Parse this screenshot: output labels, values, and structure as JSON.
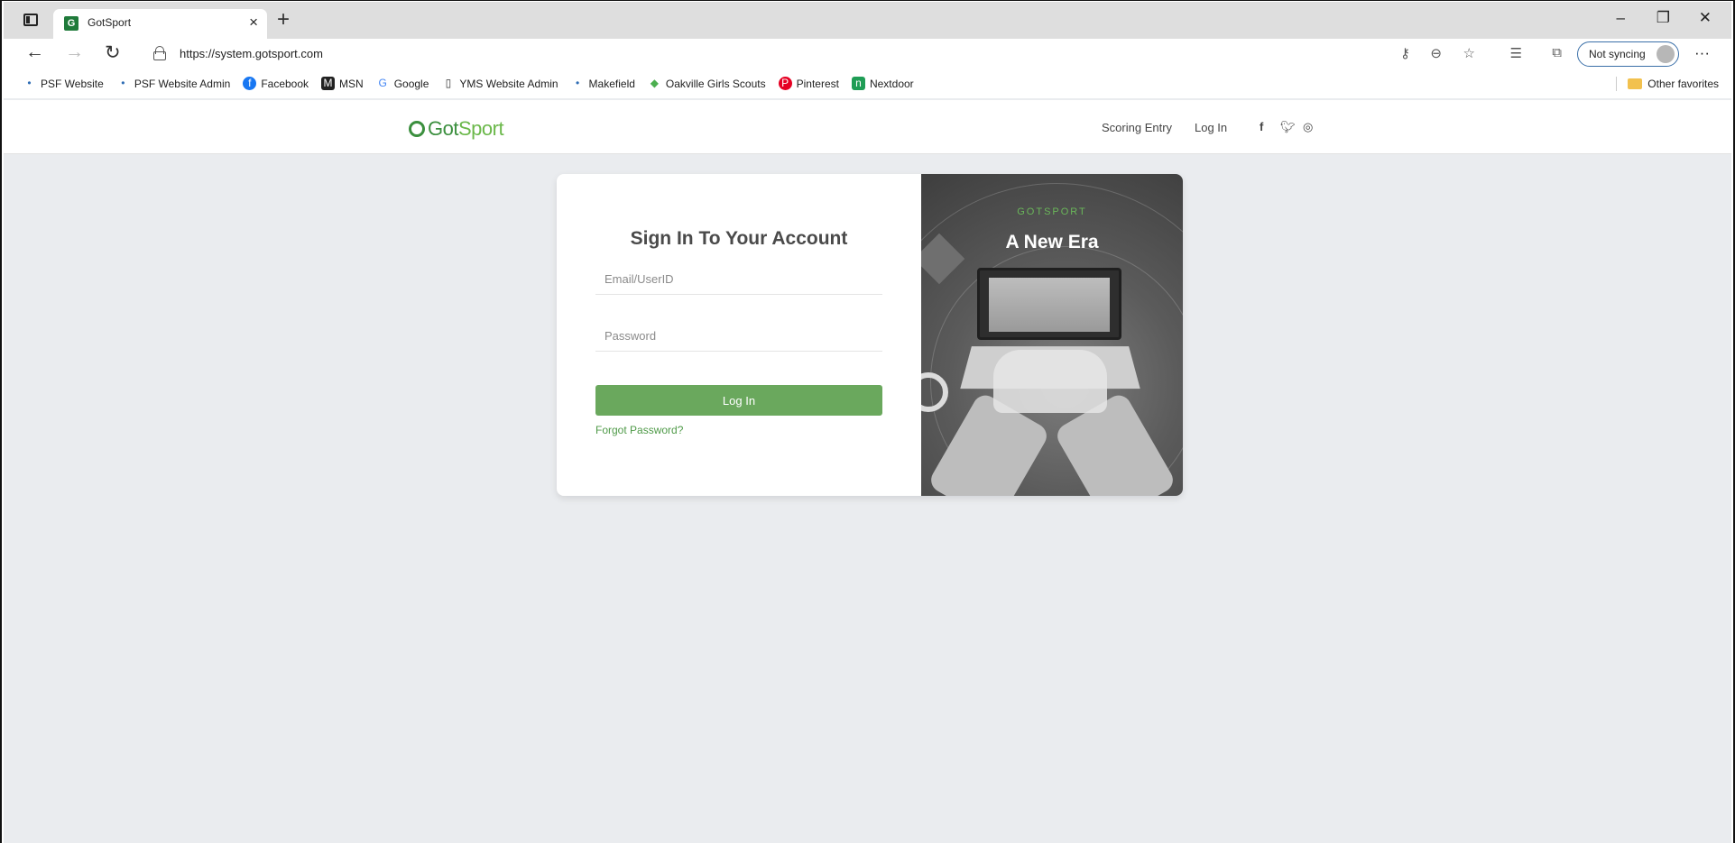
{
  "browser": {
    "tab": {
      "title": "GotSport"
    },
    "address": {
      "url": "https://system.gotsport.com"
    },
    "sync": {
      "label": "Not syncing"
    },
    "favorites": [
      {
        "label": "PSF Website",
        "icon": "dots-icon"
      },
      {
        "label": "PSF Website Admin",
        "icon": "dots-icon"
      },
      {
        "label": "Facebook",
        "icon": "facebook-icon"
      },
      {
        "label": "MSN",
        "icon": "msn-icon"
      },
      {
        "label": "Google",
        "icon": "google-icon"
      },
      {
        "label": "YMS Website Admin",
        "icon": "page-icon"
      },
      {
        "label": "Makefield",
        "icon": "dots-icon"
      },
      {
        "label": "Oakville Girls Scouts",
        "icon": "leaf-icon"
      },
      {
        "label": "Pinterest",
        "icon": "pinterest-icon"
      },
      {
        "label": "Nextdoor",
        "icon": "nextdoor-icon"
      }
    ],
    "other_favorites": "Other favorites"
  },
  "site": {
    "logo": {
      "part1": "Got",
      "part2": "Sport"
    },
    "nav": {
      "scoring": "Scoring Entry",
      "login": "Log In"
    }
  },
  "login": {
    "title": "Sign In To Your Account",
    "email_placeholder": "Email/UserID",
    "password_placeholder": "Password",
    "button": "Log In",
    "forgot": "Forgot Password?"
  },
  "promo": {
    "kicker": "GOTSPORT",
    "headline": "A New Era"
  },
  "colors": {
    "brand_green": "#6aa85d",
    "link_green": "#4f9a48",
    "page_bg": "#eaecef"
  }
}
